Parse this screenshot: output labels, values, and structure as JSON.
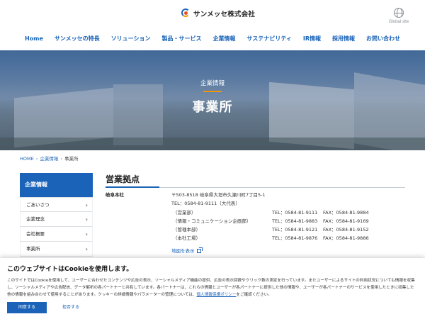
{
  "header": {
    "logo_text": "サンメッセ株式会社",
    "global_label": "Global site"
  },
  "nav": {
    "items": [
      "Home",
      "サンメッセの特長",
      "ソリューション",
      "製品・サービス",
      "企業情報",
      "サステナビリティ",
      "IR情報",
      "採用情報",
      "お問い合わせ"
    ]
  },
  "hero": {
    "subtitle": "企業情報",
    "title": "事業所"
  },
  "breadcrumb": {
    "items": [
      "HOME",
      "企業情報",
      "事業所"
    ]
  },
  "sidebar": {
    "heading": "企業情報",
    "items": [
      "ごあいさつ",
      "企業理念",
      "会社概要",
      "事業所"
    ]
  },
  "main": {
    "section_title": "営業拠点",
    "branch_name": "岐阜本社",
    "address": "〒503-8518 岐阜県大垣市久瀬川町7丁目5-1",
    "tel_main": "TEL：0584-81-9111（大代表）",
    "departments": [
      {
        "name": "（営業部）",
        "tel": "TEL：0584-81-9111",
        "fax": "FAX：0584-81-9884"
      },
      {
        "name": "（情報・コミュニケーション企画部）",
        "tel": "TEL：0584-81-9883",
        "fax": "FAX：0584-81-9169"
      },
      {
        "name": "（管理本部）",
        "tel": "TEL：0584-81-9121",
        "fax": "FAX：0584-81-9152"
      },
      {
        "name": "（本社工場）",
        "tel": "TEL：0584-81-9876",
        "fax": "FAX：0584-81-9886"
      }
    ],
    "map_link": "地図を表示"
  },
  "cookie": {
    "title": "このウェブサイトはCookieを使用します。",
    "body": "このサイトではCookieを使用して、ユーザーに合わせたコンテンツや広告の表示、ソーシャルメディア機能の提供、広告の表示回数やクリック数の測定を行っています。またユーザーによるサイトの利用状況についても情報を収集し、ソーシャルメディアや広告配信、データ解析の各パートナーと共有しています。各パートナーは、これらの情報とユーザーが各パートナーに提供した他の情報や、ユーザーが各パートナーのサービスを使用したときに収集した他の情報を組み合わせて使用することがあります。クッキーの詳細情報やパラメーターの管理については、",
    "policy_link": "個人情報保護ポリシー",
    "body_end": "をご確認ください。",
    "agree": "同意する",
    "reject": "拒否する"
  },
  "colors": {
    "brand_blue": "#1a63b8",
    "accent_orange": "#f29600"
  }
}
